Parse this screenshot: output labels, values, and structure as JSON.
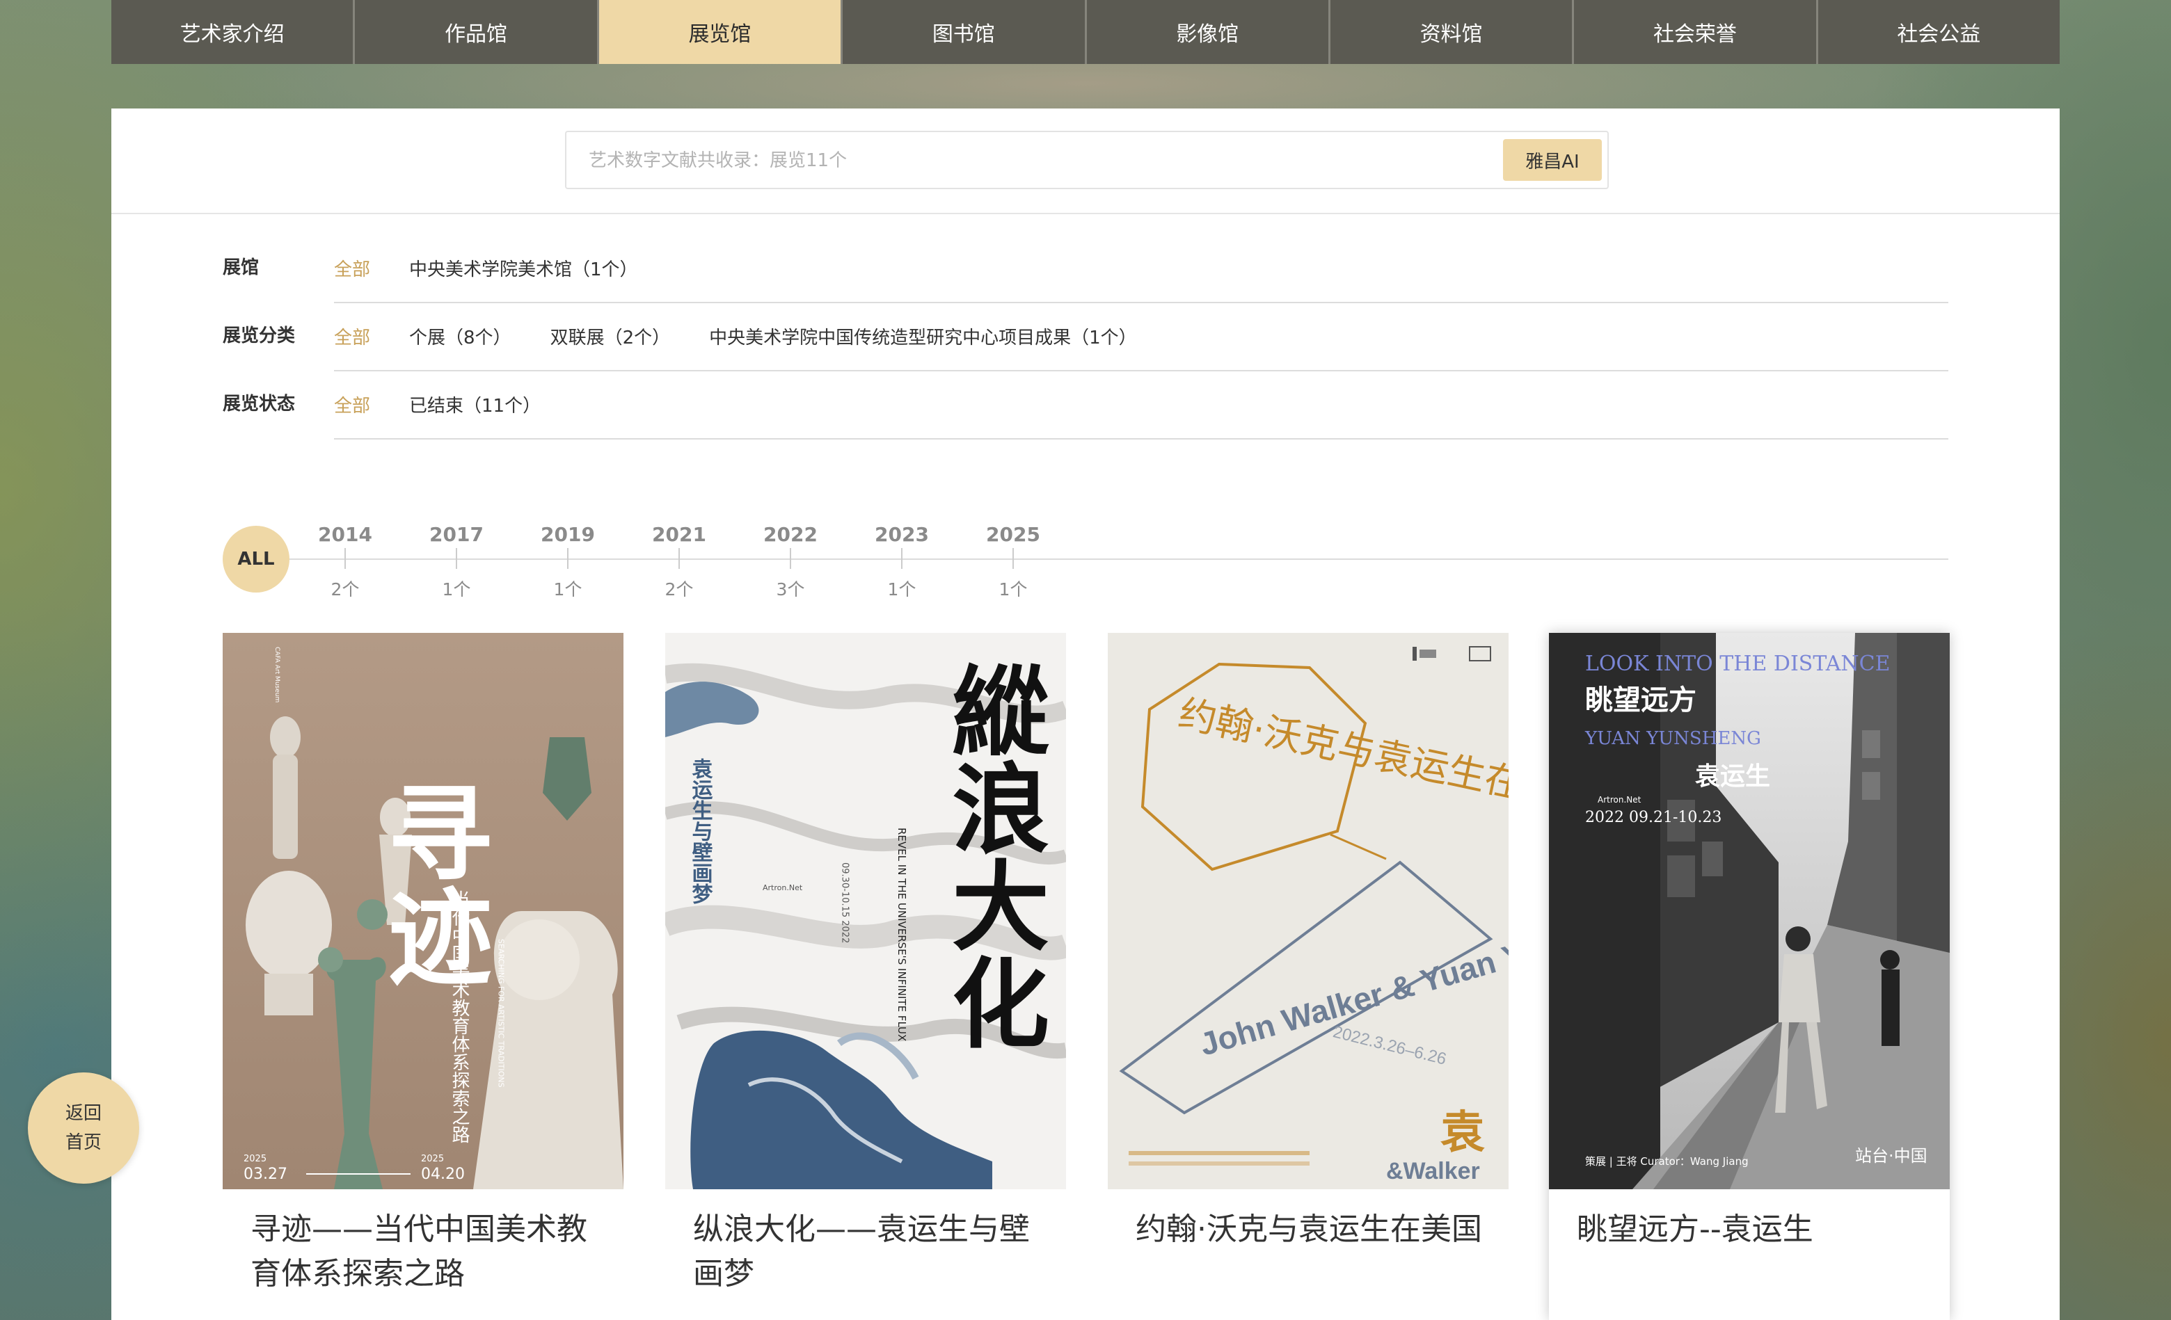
{
  "nav": {
    "items": [
      "艺术家介绍",
      "作品馆",
      "展览馆",
      "图书馆",
      "影像馆",
      "资料馆",
      "社会荣誉",
      "社会公益"
    ],
    "active_index": 2
  },
  "search": {
    "placeholder": "艺术数字文献共收录：展览11个",
    "ai_button": "雅昌AI"
  },
  "filters": [
    {
      "label": "展馆",
      "options": [
        "全部",
        "中央美术学院美术馆（1个）"
      ]
    },
    {
      "label": "展览分类",
      "options": [
        "全部",
        "个展（8个）",
        "双联展（2个）",
        "中央美术学院中国传统造型研究中心项目成果（1个）"
      ]
    },
    {
      "label": "展览状态",
      "options": [
        "全部",
        "已结束（11个）"
      ]
    }
  ],
  "timeline": {
    "all_label": "ALL",
    "years": [
      {
        "year": "2014",
        "count": "2个"
      },
      {
        "year": "2017",
        "count": "1个"
      },
      {
        "year": "2019",
        "count": "1个"
      },
      {
        "year": "2021",
        "count": "2个"
      },
      {
        "year": "2022",
        "count": "3个"
      },
      {
        "year": "2023",
        "count": "1个"
      },
      {
        "year": "2025",
        "count": "1个"
      }
    ]
  },
  "exhibitions": [
    {
      "title": "寻迹——当代中国美术教育体系探索之路",
      "poster": {
        "big": "寻迹",
        "sub": "当代中国美术教育体系探索之路",
        "date_start": "03.27",
        "date_end": "04.20",
        "year_a": "2025",
        "year_b": "2025",
        "museum": "CAFA Art Museum",
        "en": "SEARCHING FOR ARTISTIC TRADITIONS"
      }
    },
    {
      "title": "纵浪大化——袁运生与壁画梦",
      "poster": {
        "big": "縱浪大化",
        "sub": "袁运生与壁画梦",
        "en": "REVEL IN THE UNIVERSE'S INFINITE FLUX",
        "date": "09.30-10.15 2022",
        "brand": "Artron.Net"
      }
    },
    {
      "title": "约翰·沃克与袁运生在美国",
      "poster": {
        "cn": "约翰·沃克与袁运生在美国",
        "en": "John Walker & Yuan Yunsheng in the United States",
        "date": "2022.3.26–6.26",
        "mark_cn": "袁",
        "mark_en": "&Walker"
      }
    },
    {
      "title": "眺望远方--袁运生",
      "poster": {
        "en_title": "LOOK INTO THE DISTANCE",
        "cn_title": "眺望远方",
        "en_name": "YUAN YUNSHENG",
        "cn_name": "袁运生",
        "brand": "Artron.Net",
        "date": "2022 09.21-10.23",
        "curator": "策展 | 王将  Curator：Wang Jiang",
        "venue": "站台·中国"
      }
    }
  ],
  "back_home": [
    "返回",
    "首页"
  ],
  "colors": {
    "accent": "#efd8a6",
    "accent_text": "#c8a15a",
    "nav_bg": "#5b5a52"
  }
}
